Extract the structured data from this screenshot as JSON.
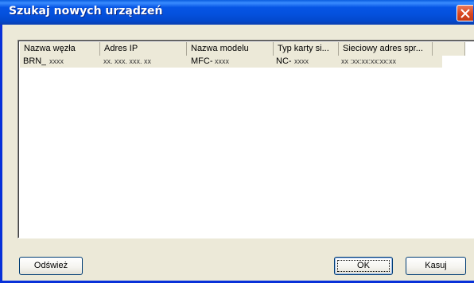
{
  "window": {
    "title": "Szukaj nowych urządzeń"
  },
  "list": {
    "columns": [
      {
        "label": "Nazwa węzła"
      },
      {
        "label": "Adres IP"
      },
      {
        "label": "Nazwa modelu"
      },
      {
        "label": "Typ karty si..."
      },
      {
        "label": "Sieciowy adres spr..."
      }
    ],
    "rows": [
      {
        "node_prefix": "BRN_",
        "node_suffix": "xxxx",
        "ip": "xx. xxx. xxx. xx",
        "model_prefix": "MFC-",
        "model_suffix": "xxxx",
        "card_prefix": "NC-",
        "card_suffix": "xxxx",
        "mac": "xx :xx:xx:xx:xx:xx"
      }
    ]
  },
  "buttons": {
    "refresh": "Odśwież",
    "ok": "OK",
    "cancel": "Kasuj"
  },
  "colors": {
    "titlebar": "#0450dc",
    "client": "#ece9d8",
    "close": "#d9461f"
  }
}
